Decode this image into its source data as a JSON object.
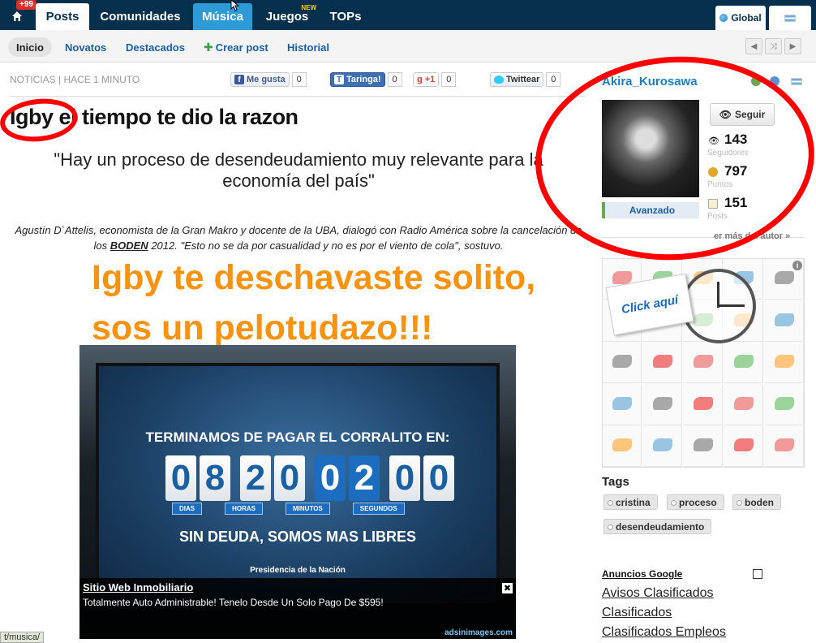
{
  "topbar": {
    "notif_badge": "+99",
    "tabs": [
      {
        "label": "Posts"
      },
      {
        "label": "Comunidades"
      },
      {
        "label": "Música"
      },
      {
        "label": "Juegos",
        "badge": "NEW"
      },
      {
        "label": "TOPs"
      }
    ],
    "global_label": "Global"
  },
  "subnav": {
    "items": [
      {
        "label": "Inicio"
      },
      {
        "label": "Novatos"
      },
      {
        "label": "Destacados"
      },
      {
        "label": "Crear post"
      },
      {
        "label": "Historial"
      }
    ]
  },
  "post": {
    "meta": "NOTICIAS | HACE 1 MINUTO",
    "social": {
      "fb_label": "Me gusta",
      "fb_count": "0",
      "taringa_label": "Taringa!",
      "taringa_count": "0",
      "gplus_label": "+1",
      "gplus_count": "0",
      "twitter_label": "Twittear",
      "twitter_count": "0"
    },
    "title": "Igby el tiempo te dio la razon",
    "quote": "\"Hay un proceso de desendeudamiento muy relevante para la economía del país\"",
    "lead_1": "Agustín D`Attelis, economista de la Gran Makro y docente de la UBA, dialogó con Radio América sobre la cancelación de los",
    "lead_bold": "BODEN",
    "lead_2": "2012. \"Esto no se da por casualidad y no es por el viento de cola\", sostuvo.",
    "orange_line_1": "Igby te deschavaste solito,",
    "orange_line_2": "sos un pelotudazo!!!"
  },
  "image": {
    "headline": "TERMINAMOS DE PAGAR EL CORRALITO EN:",
    "digits": [
      "0",
      "8",
      "2",
      "0",
      "0",
      "2",
      "0",
      "0"
    ],
    "labels": [
      "DIAS",
      "HORAS",
      "MINUTOS",
      "SEGUNDOS"
    ],
    "footer": "SIN DEUDA, SOMOS MAS LIBRES",
    "logos": "Presidencia de la Nación",
    "ad": {
      "title": "Sitio Web Inmobiliario",
      "text": "Totalmente Auto Administrable! Tenelo Desde Un Solo Pago De $595!",
      "source": "adsinimages.com",
      "close": "✖"
    }
  },
  "statusbar": "t/musica/",
  "author": {
    "name": "Akira_Kurosawa",
    "follow_label": "Seguir",
    "followers": "143",
    "followers_label": "Seguidores",
    "points": "797",
    "points_label": "Puntos",
    "posts": "151",
    "posts_label": "Posts",
    "level": "Avanzado",
    "more_link": "er más del autor »"
  },
  "sidebar_ad": {
    "click_label": "Click aquí",
    "info": "i"
  },
  "tags": {
    "heading": "Tags",
    "items": [
      "cristina",
      "proceso",
      "boden",
      "desendeudamiento"
    ]
  },
  "google_ads": {
    "heading": "Anuncios Google",
    "links": [
      "Avisos Clasificados",
      "Clasificados",
      "Clasificados Empleos"
    ]
  },
  "colors": {
    "topbar_bg": "#04304d",
    "accent_blue": "#1a7fc0",
    "orange_text": "#f7930f",
    "annotation_red": "#ff0000"
  }
}
